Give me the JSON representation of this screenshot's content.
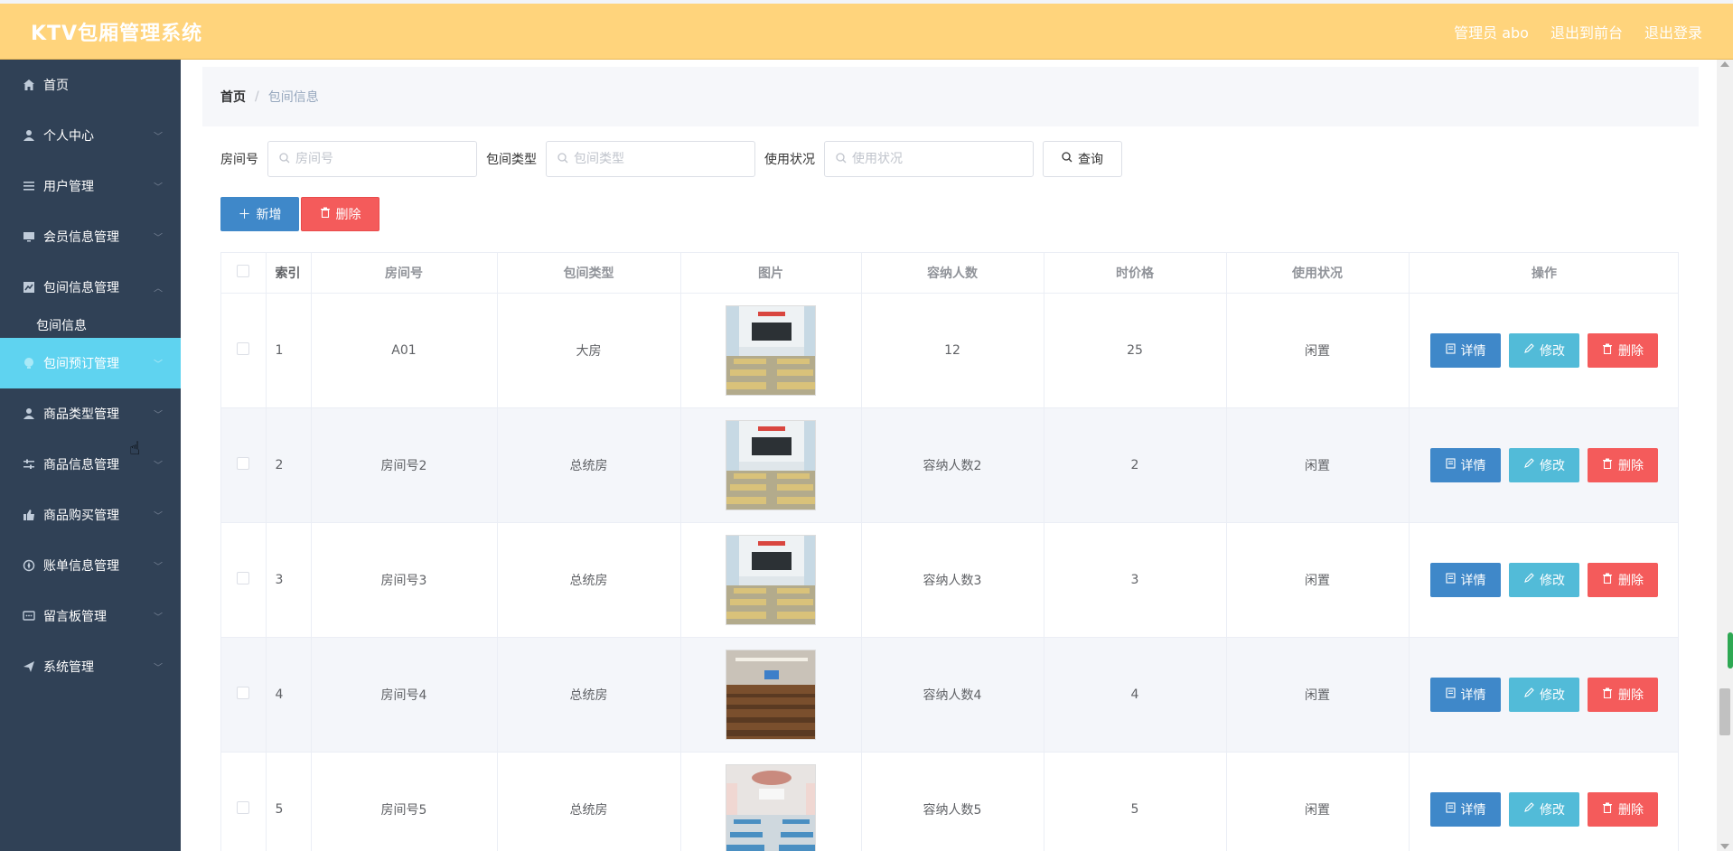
{
  "header": {
    "title": "KTV包厢管理系统",
    "admin": "管理员 abo",
    "to_front": "退出到前台",
    "logout": "退出登录"
  },
  "sidebar": {
    "items": [
      {
        "label": "首页",
        "icon": "home-icon"
      },
      {
        "label": "个人中心",
        "icon": "user-icon"
      },
      {
        "label": "用户管理",
        "icon": "list-icon"
      },
      {
        "label": "会员信息管理",
        "icon": "monitor-icon"
      },
      {
        "label": "包间信息管理",
        "icon": "chart-icon"
      },
      {
        "label": "包间预订管理",
        "icon": "bulb-icon"
      },
      {
        "label": "商品类型管理",
        "icon": "user-icon"
      },
      {
        "label": "商品信息管理",
        "icon": "sliders-icon"
      },
      {
        "label": "商品购买管理",
        "icon": "thumb-icon"
      },
      {
        "label": "账单信息管理",
        "icon": "compass-icon"
      },
      {
        "label": "留言板管理",
        "icon": "chat-icon"
      },
      {
        "label": "系统管理",
        "icon": "send-icon"
      }
    ],
    "sub_item": "包间信息"
  },
  "breadcrumb": {
    "home": "首页",
    "separator": "/",
    "current": "包间信息"
  },
  "search": {
    "room_label": "房间号",
    "room_placeholder": "房间号",
    "type_label": "包间类型",
    "type_placeholder": "包间类型",
    "status_label": "使用状况",
    "status_placeholder": "使用状况",
    "query_label": "查询"
  },
  "actions": {
    "add_label": "新增",
    "delete_label": "删除"
  },
  "table": {
    "headers": {
      "index": "索引",
      "room": "房间号",
      "type": "包间类型",
      "image": "图片",
      "capacity": "容纳人数",
      "price": "时价格",
      "status": "使用状况",
      "ops": "操作"
    },
    "rows": [
      {
        "index": "1",
        "room": "A01",
        "type": "大房",
        "capacity": "12",
        "price": "25",
        "status": "闲置"
      },
      {
        "index": "2",
        "room": "房间号2",
        "type": "总统房",
        "capacity": "容纳人数2",
        "price": "2",
        "status": "闲置"
      },
      {
        "index": "3",
        "room": "房间号3",
        "type": "总统房",
        "capacity": "容纳人数3",
        "price": "3",
        "status": "闲置"
      },
      {
        "index": "4",
        "room": "房间号4",
        "type": "总统房",
        "capacity": "容纳人数4",
        "price": "4",
        "status": "闲置"
      },
      {
        "index": "5",
        "room": "房间号5",
        "type": "总统房",
        "capacity": "容纳人数5",
        "price": "5",
        "status": "闲置"
      }
    ],
    "op_detail": "详情",
    "op_edit": "修改",
    "op_delete": "删除"
  },
  "colors": {
    "header_bg": "#ffd47c",
    "sidebar_bg": "#304156",
    "active_menu": "#5fd3f0",
    "primary": "#3f88c9",
    "info": "#52bbd8",
    "danger": "#f45b5b"
  }
}
